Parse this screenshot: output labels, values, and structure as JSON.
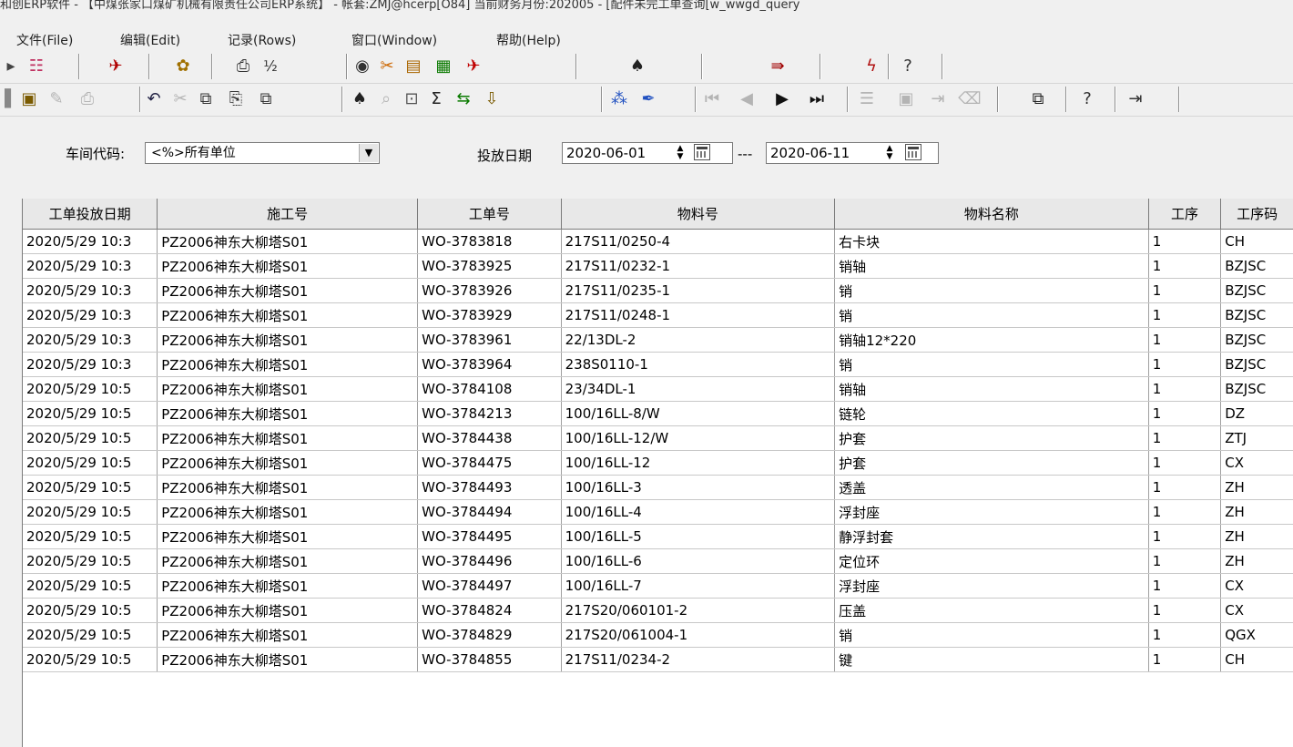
{
  "window": {
    "title": "和创ERP软件 - 【中煤张家口煤矿机械有限责任公司ERP系统】 - 帐套:ZMJ@hcerp[O84]  当前财务月份:202005 - [配件未完工单查询[w_wwgd_query"
  },
  "menu": {
    "items": [
      "文件(File)",
      "编辑(Edit)",
      "记录(Rows)",
      "窗口(Window)",
      "帮助(Help)"
    ]
  },
  "filters": {
    "workshop_label": "车间代码:",
    "workshop_value": "<%>所有单位",
    "date_label": "投放日期",
    "date_from": "2020-06-01",
    "date_to": "2020-06-11",
    "date_separator": "---"
  },
  "table": {
    "columns": [
      "工单投放日期",
      "施工号",
      "工单号",
      "物料号",
      "物料名称",
      "工序",
      "工序码"
    ],
    "rows": [
      [
        "2020/5/29 10:3",
        "PZ2006神东大柳塔S01",
        "WO-3783818",
        "217S11/0250-4",
        "右卡块",
        "1",
        "CH"
      ],
      [
        "2020/5/29 10:3",
        "PZ2006神东大柳塔S01",
        "WO-3783925",
        "217S11/0232-1",
        "销轴",
        "1",
        "BZJSC"
      ],
      [
        "2020/5/29 10:3",
        "PZ2006神东大柳塔S01",
        "WO-3783926",
        "217S11/0235-1",
        "销",
        "1",
        "BZJSC"
      ],
      [
        "2020/5/29 10:3",
        "PZ2006神东大柳塔S01",
        "WO-3783929",
        "217S11/0248-1",
        "销",
        "1",
        "BZJSC"
      ],
      [
        "2020/5/29 10:3",
        "PZ2006神东大柳塔S01",
        "WO-3783961",
        "22/13DL-2",
        "销轴12*220",
        "1",
        "BZJSC"
      ],
      [
        "2020/5/29 10:3",
        "PZ2006神东大柳塔S01",
        "WO-3783964",
        "238S0110-1",
        "销",
        "1",
        "BZJSC"
      ],
      [
        "2020/5/29 10:5",
        "PZ2006神东大柳塔S01",
        "WO-3784108",
        "23/34DL-1",
        "销轴",
        "1",
        "BZJSC"
      ],
      [
        "2020/5/29 10:5",
        "PZ2006神东大柳塔S01",
        "WO-3784213",
        "100/16LL-8/W",
        "链轮",
        "1",
        "DZ"
      ],
      [
        "2020/5/29 10:5",
        "PZ2006神东大柳塔S01",
        "WO-3784438",
        "100/16LL-12/W",
        "护套",
        "1",
        "ZTJ"
      ],
      [
        "2020/5/29 10:5",
        "PZ2006神东大柳塔S01",
        "WO-3784475",
        "100/16LL-12",
        "护套",
        "1",
        "CX"
      ],
      [
        "2020/5/29 10:5",
        "PZ2006神东大柳塔S01",
        "WO-3784493",
        "100/16LL-3",
        "透盖",
        "1",
        "ZH"
      ],
      [
        "2020/5/29 10:5",
        "PZ2006神东大柳塔S01",
        "WO-3784494",
        "100/16LL-4",
        "浮封座",
        "1",
        "ZH"
      ],
      [
        "2020/5/29 10:5",
        "PZ2006神东大柳塔S01",
        "WO-3784495",
        "100/16LL-5",
        "静浮封套",
        "1",
        "ZH"
      ],
      [
        "2020/5/29 10:5",
        "PZ2006神东大柳塔S01",
        "WO-3784496",
        "100/16LL-6",
        "定位环",
        "1",
        "ZH"
      ],
      [
        "2020/5/29 10:5",
        "PZ2006神东大柳塔S01",
        "WO-3784497",
        "100/16LL-7",
        "浮封座",
        "1",
        "CX"
      ],
      [
        "2020/5/29 10:5",
        "PZ2006神东大柳塔S01",
        "WO-3784824",
        "217S20/060101-2",
        "压盖",
        "1",
        "CX"
      ],
      [
        "2020/5/29 10:5",
        "PZ2006神东大柳塔S01",
        "WO-3784829",
        "217S20/061004-1",
        "销",
        "1",
        "QGX"
      ],
      [
        "2020/5/29 10:5",
        "PZ2006神东大柳塔S01",
        "WO-3784855",
        "217S11/0234-2",
        "键",
        "1",
        "CH"
      ]
    ]
  },
  "toolbar1": [
    "sort-icon",
    "filter-icon",
    "print-setup-icon",
    "print-icon",
    "fraction-icon",
    "view-icon",
    "tools-icon",
    "document-icon",
    "calculator-icon",
    "chart-icon",
    "find-icon",
    "export-icon",
    "lightning-icon",
    "help-icon"
  ],
  "toolbar2": [
    "save-icon",
    "edit-icon",
    "print-icon",
    "undo-icon",
    "cut-icon",
    "copy-icon",
    "paste-icon",
    "paste-special-icon",
    "find-icon",
    "search-icon",
    "query-icon",
    "sum-icon",
    "swap-icon",
    "retrieve-icon",
    "link-icon",
    "brush-icon",
    "first-icon",
    "prior-icon",
    "next-icon",
    "last-icon",
    "insert-row-icon",
    "delete-row-icon",
    "append-icon",
    "clear-icon",
    "window-icon",
    "help-icon",
    "exit-icon"
  ]
}
